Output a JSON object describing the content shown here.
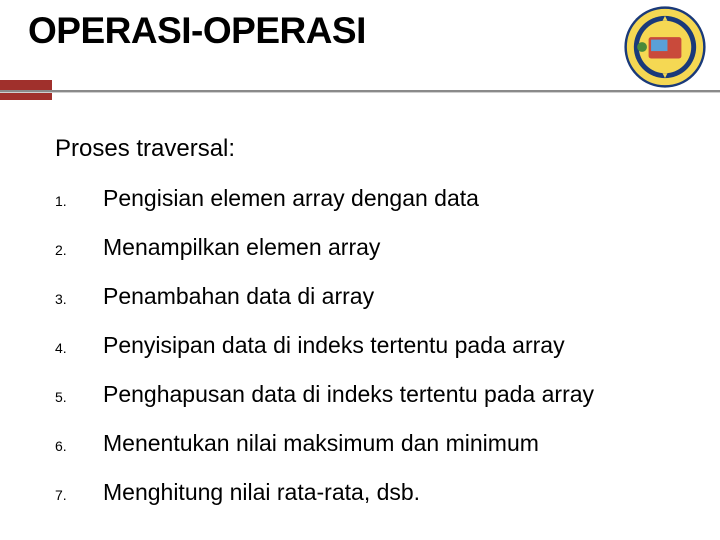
{
  "title": "OPERASI-OPERASI",
  "subtitle": "Proses traversal:",
  "emblem_name": "unikom-logo",
  "items": [
    {
      "num": "1.",
      "text": "Pengisian elemen array dengan data"
    },
    {
      "num": "2.",
      "text": "Menampilkan elemen array"
    },
    {
      "num": "3.",
      "text": "Penambahan data di array"
    },
    {
      "num": "4.",
      "text": "Penyisipan data di indeks tertentu pada array"
    },
    {
      "num": "5.",
      "text": "Penghapusan data di indeks tertentu pada array"
    },
    {
      "num": "6.",
      "text": "Menentukan nilai maksimum dan minimum"
    },
    {
      "num": "7.",
      "text": "Menghitung nilai rata-rata, dsb."
    }
  ]
}
